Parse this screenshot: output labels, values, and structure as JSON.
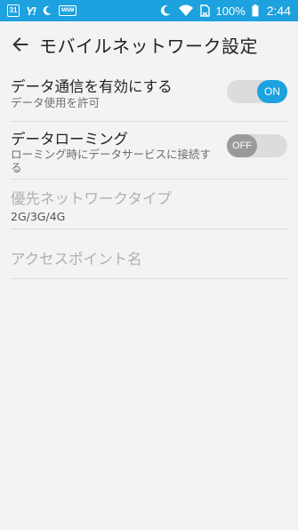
{
  "status_bar": {
    "calendar_day": "31",
    "yahoo_label": "Y!",
    "mnm_label": "MNM",
    "battery": "100%",
    "time": "2:44",
    "background_color": "#1da1df"
  },
  "header": {
    "title": "モバイルネットワーク設定",
    "back_icon": "arrow-left-icon"
  },
  "settings": {
    "data_enabled": {
      "title": "データ通信を有効にする",
      "subtitle": "データ使用を許可",
      "toggle_label": "ON",
      "checked": true
    },
    "data_roaming": {
      "title": "データローミング",
      "subtitle": "ローミング時にデータサービスに接続する",
      "toggle_label": "OFF",
      "checked": false
    },
    "preferred_network": {
      "title": "優先ネットワークタイプ",
      "value": "2G/3G/4G"
    },
    "access_point": {
      "title": "アクセスポイント名"
    }
  },
  "colors": {
    "accent": "#1da1df",
    "background": "#f3f3f3"
  }
}
